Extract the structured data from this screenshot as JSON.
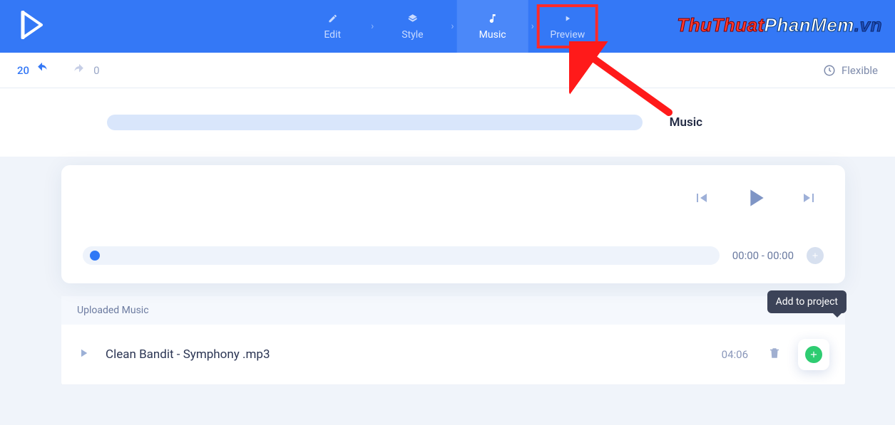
{
  "header": {
    "steps": {
      "edit": "Edit",
      "style": "Style",
      "music": "Music",
      "preview": "Preview"
    },
    "watermark": {
      "a": "ThuThuat",
      "b": "PhanMem",
      "c": ".vn"
    }
  },
  "toolbar": {
    "undo_count": "20",
    "redo_count": "0",
    "flexible": "Flexible"
  },
  "section": {
    "label": "Music"
  },
  "player": {
    "time": "00:00 - 00:00"
  },
  "tooltip": {
    "add_to_project": "Add to project"
  },
  "uploaded": {
    "heading": "Uploaded Music",
    "items": [
      {
        "title": "Clean Bandit - Symphony .mp3",
        "duration": "04:06"
      }
    ]
  }
}
